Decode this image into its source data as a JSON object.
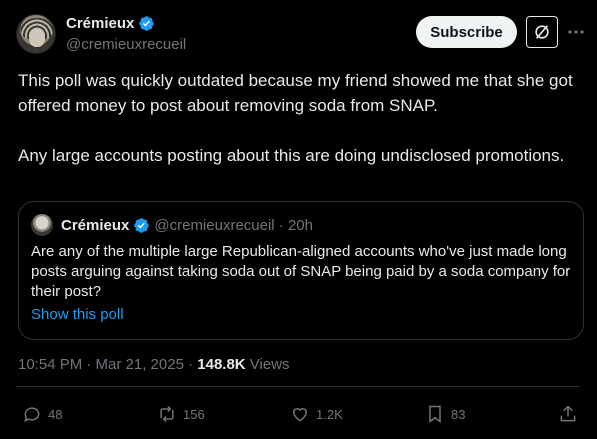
{
  "author": {
    "name": "Crémieux",
    "handle": "@cremieuxrecueil",
    "verified": true
  },
  "header": {
    "subscribe_label": "Subscribe",
    "grok_icon": "slashed-circle-icon",
    "more_icon": "more-icon"
  },
  "tweet": {
    "paragraphs": [
      "This poll was quickly outdated because my friend showed me that she got offered money to post about removing soda from SNAP.",
      "Any large accounts posting about this are doing undisclosed promotions."
    ]
  },
  "quote": {
    "name": "Crémieux",
    "handle_time": "@cremieuxrecueil · 20h",
    "text": "Are any of the multiple large Republican-aligned accounts who've just made long posts arguing against taking soda out of SNAP being paid by a soda company for their post?",
    "link": "Show this poll"
  },
  "meta": {
    "timestamp": "10:54 PM · Mar 21, 2025 · ",
    "views_count": "148.8K",
    "views_label": " Views"
  },
  "actions": {
    "replies": "48",
    "reposts": "156",
    "likes": "1.2K",
    "bookmarks": "83"
  },
  "colors": {
    "background": "#000000",
    "text": "#e7e9ea",
    "muted": "#71767b",
    "accent": "#1d9bf0",
    "border": "#2f3336"
  }
}
